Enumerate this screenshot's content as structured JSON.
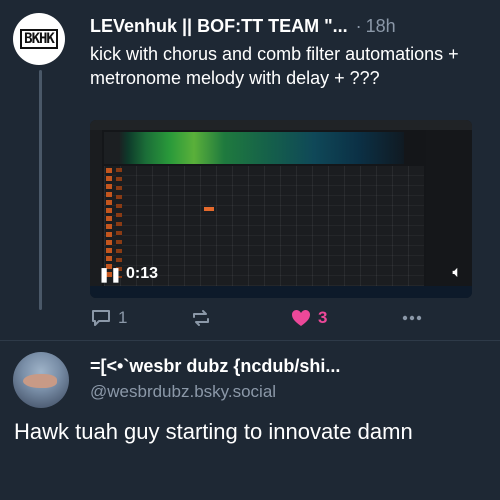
{
  "post1": {
    "avatar_text": "BKHK",
    "author": "LEVenhuk || BOF:TT TEAM \"...",
    "separator": "·",
    "time": "18h",
    "text": "kick with chorus and comb filter automations + metronome melody with delay + ???",
    "video": {
      "timecode": "0:13",
      "play_icon": "pause-icon",
      "mute_icon": "speaker-icon"
    },
    "actions": {
      "reply_count": "1",
      "repost_count": "",
      "like_count": "3",
      "like_color": "#ec4899"
    }
  },
  "post2": {
    "author": "=[<•`wesbr dubz {ncdub/shi...",
    "handle": "@wesbrdubz.bsky.social",
    "text": "Hawk tuah guy starting to innovate damn"
  },
  "colors": {
    "background": "#1e2834",
    "muted_text": "#8b98a8",
    "accent_like": "#ec4899"
  }
}
